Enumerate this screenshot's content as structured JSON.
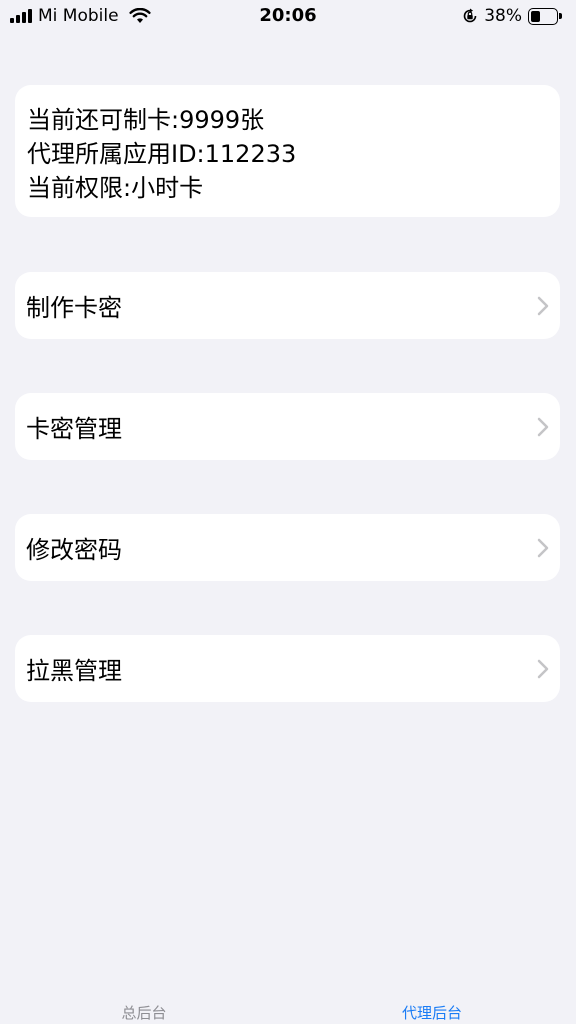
{
  "status_bar": {
    "carrier": "Mi Mobile",
    "time": "20:06",
    "battery_percent": "38%",
    "battery_level": 0.38
  },
  "info": {
    "line1": "当前还可制卡:9999张",
    "line2": "代理所属应用ID:112233",
    "line3": "当前权限:小时卡"
  },
  "menu": [
    {
      "label": "制作卡密",
      "icon": "chevron-right-icon"
    },
    {
      "label": "卡密管理",
      "icon": "chevron-right-icon"
    },
    {
      "label": "修改密码",
      "icon": "chevron-right-icon"
    },
    {
      "label": "拉黑管理",
      "icon": "chevron-right-icon"
    }
  ],
  "tabs": [
    {
      "label": "总后台",
      "active": false
    },
    {
      "label": "代理后台",
      "active": true
    }
  ],
  "colors": {
    "background": "#f2f2f7",
    "card": "#ffffff",
    "tab_active": "#1a7cf5",
    "tab_inactive": "#8e8e93",
    "chevron": "#c4c4c7"
  }
}
